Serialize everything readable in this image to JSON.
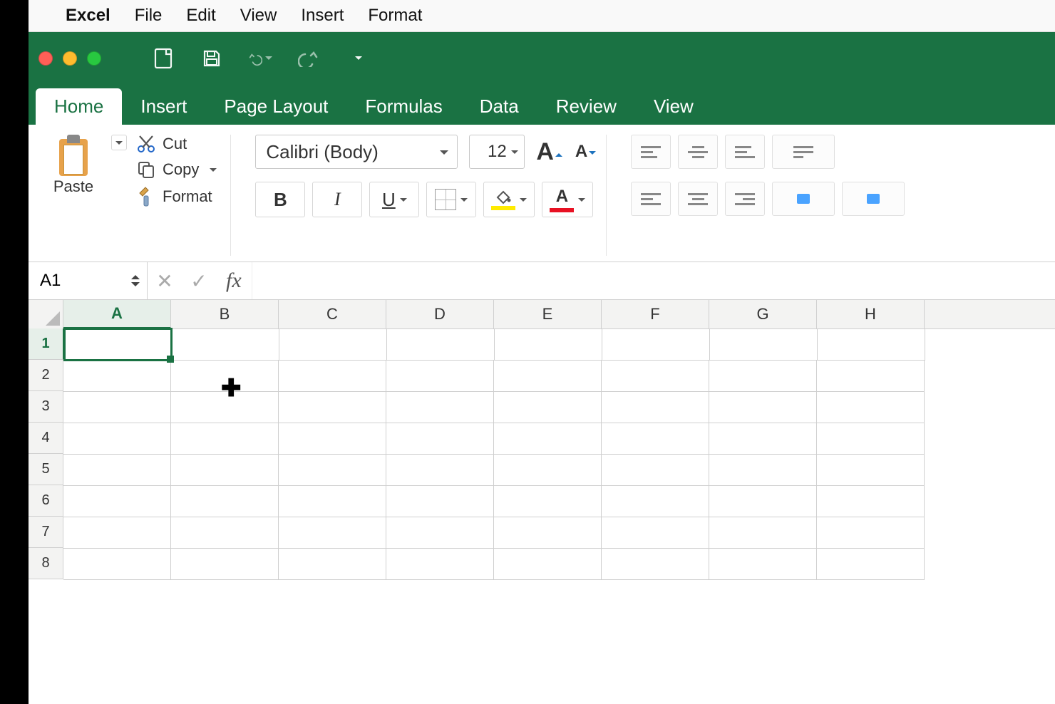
{
  "mac_menubar": {
    "app_name": "Excel",
    "items": [
      "File",
      "Edit",
      "View",
      "Insert",
      "Format"
    ]
  },
  "ribbon_tabs": {
    "active": "Home",
    "tabs": [
      "Home",
      "Insert",
      "Page Layout",
      "Formulas",
      "Data",
      "Review",
      "View"
    ]
  },
  "clipboard": {
    "paste": "Paste",
    "cut": "Cut",
    "copy": "Copy",
    "format": "Format"
  },
  "font": {
    "name": "Calibri (Body)",
    "size": "12",
    "bold": "B",
    "italic": "I",
    "underline": "U",
    "grow_label": "A",
    "shrink_label": "A",
    "fill_label": "A",
    "color_label": "A"
  },
  "formula_bar": {
    "name_box": "A1",
    "cancel": "✕",
    "enter": "✓",
    "fx": "fx",
    "value": ""
  },
  "sheet": {
    "columns": [
      "A",
      "B",
      "C",
      "D",
      "E",
      "F",
      "G",
      "H"
    ],
    "rows": [
      "1",
      "2",
      "3",
      "4",
      "5",
      "6",
      "7",
      "8"
    ],
    "selected": "A1"
  }
}
